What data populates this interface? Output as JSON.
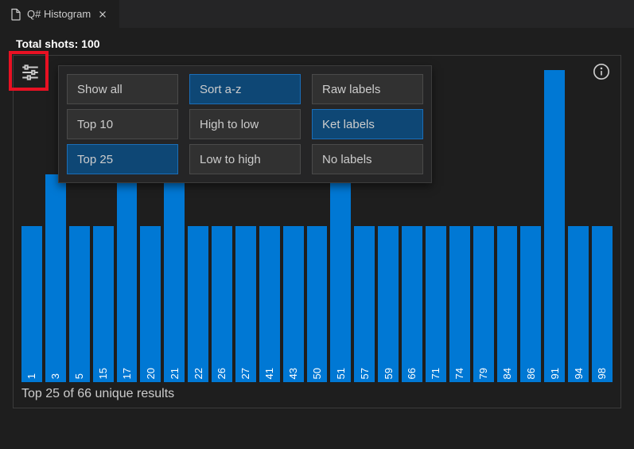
{
  "tab": {
    "title": "Q# Histogram"
  },
  "header": {
    "total_shots_label": "Total shots: 100"
  },
  "options": {
    "groups": [
      {
        "buttons": [
          {
            "label": "Show all",
            "selected": false
          },
          {
            "label": "Top 10",
            "selected": false
          },
          {
            "label": "Top 25",
            "selected": true
          }
        ]
      },
      {
        "buttons": [
          {
            "label": "Sort a-z",
            "selected": true
          },
          {
            "label": "High to low",
            "selected": false
          },
          {
            "label": "Low to high",
            "selected": false
          }
        ]
      },
      {
        "buttons": [
          {
            "label": "Raw labels",
            "selected": false
          },
          {
            "label": "Ket labels",
            "selected": true
          },
          {
            "label": "No labels",
            "selected": false
          }
        ]
      }
    ]
  },
  "footer": {
    "text": "Top 25 of 66 unique results"
  },
  "chart_data": {
    "type": "bar",
    "title": "Q# Histogram",
    "xlabel": "",
    "ylabel": "",
    "ylim": [
      0,
      6
    ],
    "categories": [
      "1",
      "3",
      "5",
      "15",
      "17",
      "20",
      "21",
      "22",
      "26",
      "27",
      "41",
      "43",
      "50",
      "51",
      "57",
      "59",
      "66",
      "71",
      "74",
      "79",
      "84",
      "86",
      "91",
      "94",
      "98"
    ],
    "values": [
      3,
      4,
      3,
      3,
      4,
      3,
      4,
      3,
      3,
      3,
      3,
      3,
      3,
      4,
      3,
      3,
      3,
      3,
      3,
      3,
      3,
      3,
      6,
      3,
      3
    ]
  }
}
